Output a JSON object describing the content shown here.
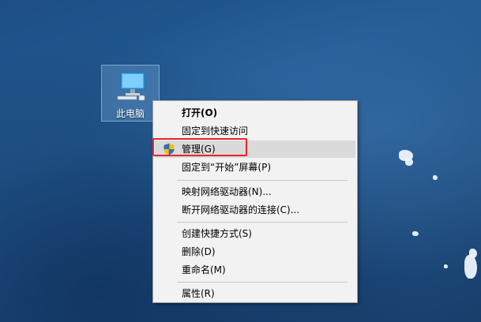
{
  "desktop": {
    "icon_label": "此电脑"
  },
  "context_menu": {
    "items": [
      {
        "label": "打开(O)",
        "bold": true
      },
      {
        "label": "固定到快速访问"
      },
      {
        "label": "管理(G)",
        "icon": "uac-shield-icon",
        "highlighted": true
      },
      {
        "label": "固定到“开始”屏幕(P)"
      },
      {
        "label": "映射网络驱动器(N)..."
      },
      {
        "label": "断开网络驱动器的连接(C)..."
      },
      {
        "label": "创建快捷方式(S)"
      },
      {
        "label": "删除(D)"
      },
      {
        "label": "重命名(M)"
      },
      {
        "label": "属性(R)"
      }
    ]
  },
  "colors": {
    "annotation_box": "#e8242b",
    "menu_background": "#f2f2f2",
    "hover_background": "#dadada"
  }
}
